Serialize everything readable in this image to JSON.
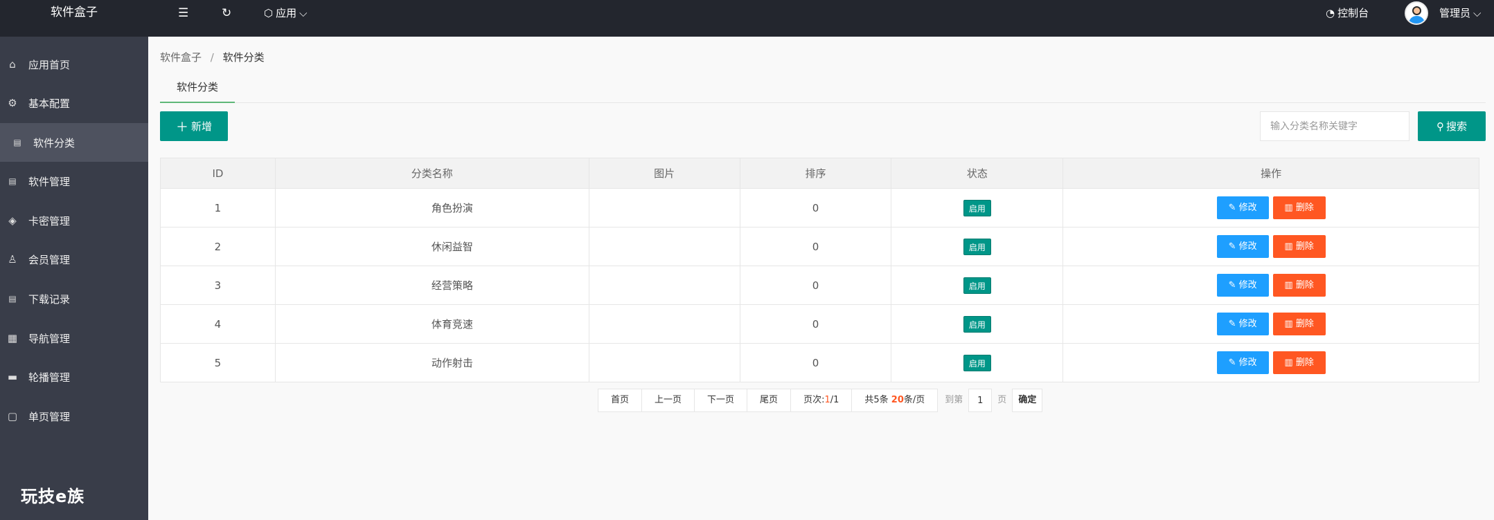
{
  "app": {
    "logo": "软件盒子"
  },
  "topbar": {
    "menu_icon": "☰",
    "refresh_icon": "↻",
    "app_label": "应用",
    "dashboard_label": "控制台",
    "user_label": "管理员"
  },
  "sidebar": {
    "items": [
      {
        "label": "应用首页",
        "icon": "home-icon",
        "glyph": "⌂"
      },
      {
        "label": "基本配置",
        "icon": "gear-icon",
        "glyph": "⚙"
      },
      {
        "label": "软件分类",
        "icon": "file-icon",
        "glyph": "▤"
      },
      {
        "label": "软件管理",
        "icon": "file-icon",
        "glyph": "▤"
      },
      {
        "label": "卡密管理",
        "icon": "layers-icon",
        "glyph": "◈"
      },
      {
        "label": "会员管理",
        "icon": "user-icon",
        "glyph": "♙"
      },
      {
        "label": "下载记录",
        "icon": "file-icon",
        "glyph": "▤"
      },
      {
        "label": "导航管理",
        "icon": "calendar-icon",
        "glyph": "▦"
      },
      {
        "label": "轮播管理",
        "icon": "image-icon",
        "glyph": "▬"
      },
      {
        "label": "单页管理",
        "icon": "page-icon",
        "glyph": "▢"
      }
    ],
    "brand": "玩技e族"
  },
  "breadcrumb": {
    "root": "软件盒子",
    "separator": "/",
    "current": "软件分类"
  },
  "tab": {
    "label": "软件分类"
  },
  "toolbar": {
    "add_label": "新增",
    "search_placeholder": "输入分类名称关键字",
    "search_label": "搜索"
  },
  "table": {
    "columns": [
      "ID",
      "分类名称",
      "图片",
      "排序",
      "状态",
      "操作"
    ],
    "rows": [
      {
        "id": "1",
        "name": "角色扮演",
        "image": "",
        "sort": "0",
        "status": "启用"
      },
      {
        "id": "2",
        "name": "休闲益智",
        "image": "",
        "sort": "0",
        "status": "启用"
      },
      {
        "id": "3",
        "name": "经营策略",
        "image": "",
        "sort": "0",
        "status": "启用"
      },
      {
        "id": "4",
        "name": "体育竞速",
        "image": "",
        "sort": "0",
        "status": "启用"
      },
      {
        "id": "5",
        "name": "动作射击",
        "image": "",
        "sort": "0",
        "status": "启用"
      }
    ],
    "edit_label": "修改",
    "delete_label": "删除"
  },
  "pagination": {
    "first": "首页",
    "prev": "上一页",
    "next": "下一页",
    "last": "尾页",
    "page_prefix": "页次:",
    "page_current": "1",
    "page_total": "/1",
    "total_prefix": "共5条 ",
    "per_page": "20",
    "per_page_suffix": "条/页",
    "goto_prefix": "到第",
    "goto_value": "1",
    "goto_suffix": "页",
    "confirm": "确定"
  },
  "colors": {
    "topbar": "#23262e",
    "sidebar": "#393d49",
    "primary": "#009688",
    "edit": "#1e9fff",
    "delete": "#ff5722"
  }
}
